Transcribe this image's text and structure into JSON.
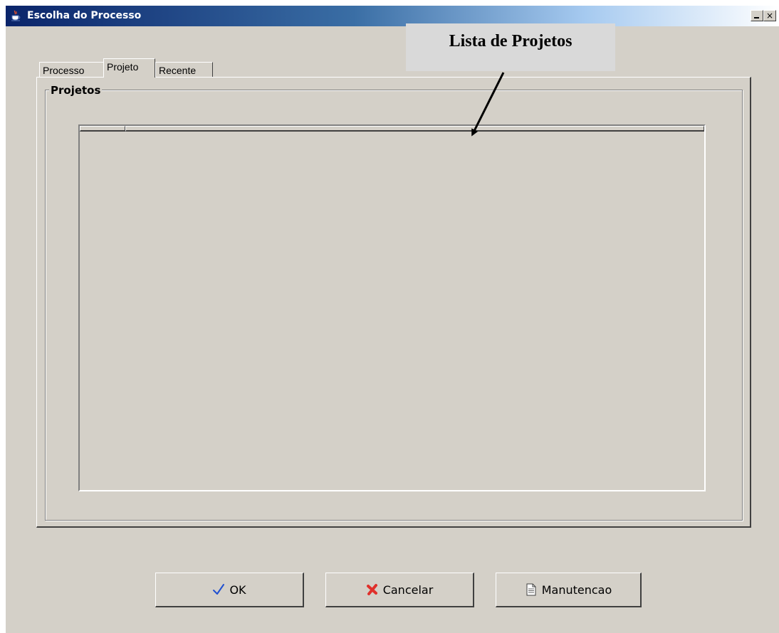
{
  "window": {
    "title": "Escolha do Processo",
    "minimize_glyph": "_",
    "close_glyph": "×"
  },
  "tabs": [
    {
      "label": "Processo",
      "selected": false
    },
    {
      "label": "Projeto",
      "selected": true
    },
    {
      "label": "Recente",
      "selected": false
    }
  ],
  "group": {
    "title": "Projetos"
  },
  "table": {
    "columns": [
      "",
      ""
    ],
    "rows": []
  },
  "callout": {
    "text": "Lista de Projetos"
  },
  "buttons": {
    "ok": {
      "label": "OK",
      "icon": "checkmark-icon"
    },
    "cancel": {
      "label": "Cancelar",
      "icon": "red-x-icon"
    },
    "maintenance": {
      "label": "Manutencao",
      "icon": "document-icon"
    }
  },
  "colors": {
    "face": "#d4d0c8",
    "titlebar_start": "#0a246a",
    "titlebar_end": "#a6caf0",
    "callout_bg": "#d9d9d9",
    "check": "#1f4fd1",
    "cancel_x": "#e0302b"
  }
}
